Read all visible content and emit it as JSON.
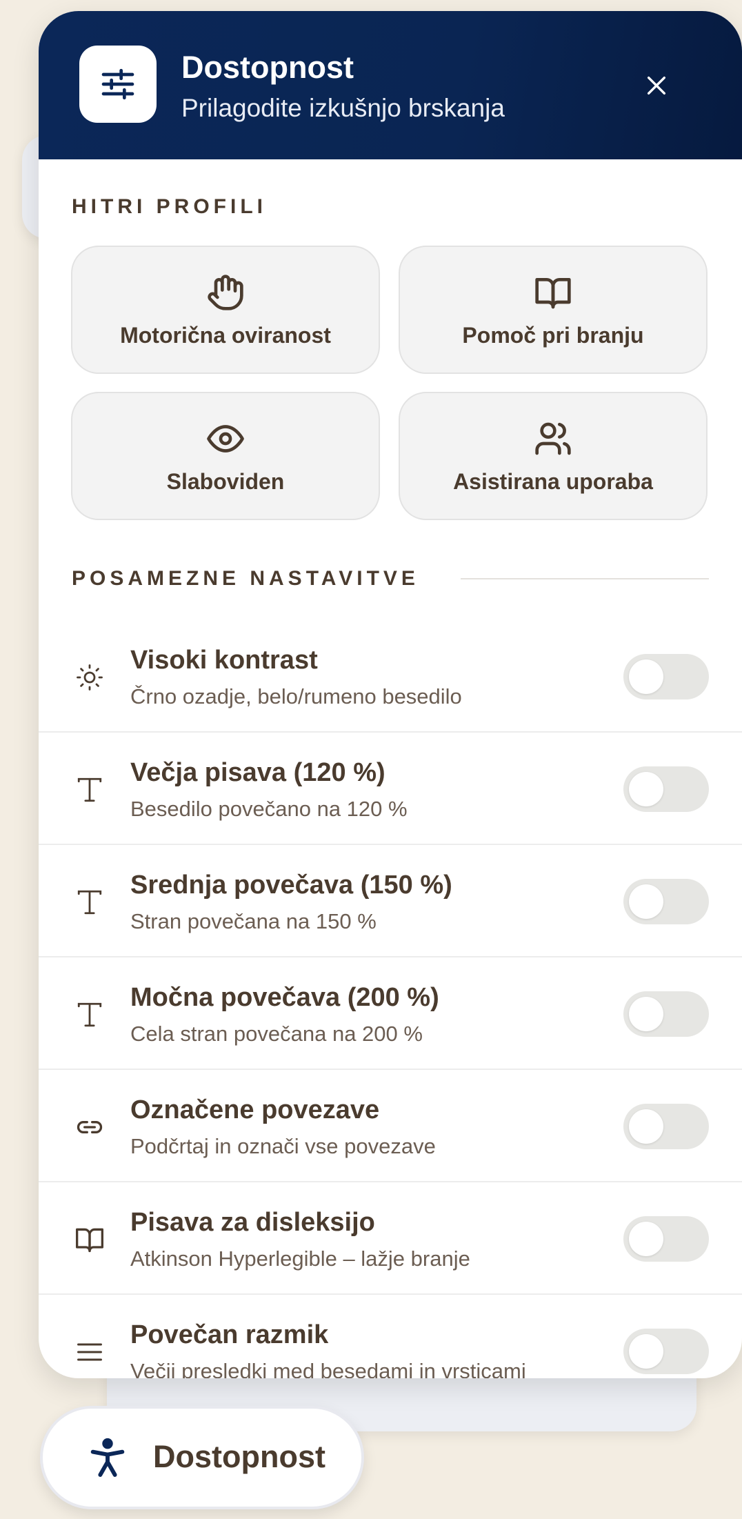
{
  "header": {
    "title": "Dostopnost",
    "subtitle": "Prilagodite izkušnjo brskanja",
    "icon": "sliders-icon",
    "close_icon": "close-icon"
  },
  "quick_profiles": {
    "label": "HITRI PROFILI",
    "items": [
      {
        "label": "Motorična oviranost",
        "icon": "hand-icon"
      },
      {
        "label": "Pomoč pri branju",
        "icon": "book-open-icon"
      },
      {
        "label": "Slaboviden",
        "icon": "eye-icon"
      },
      {
        "label": "Asistirana uporaba",
        "icon": "users-icon"
      }
    ]
  },
  "settings": {
    "label": "POSAMEZNE NASTAVITVE",
    "items": [
      {
        "title": "Visoki kontrast",
        "description": "Črno ozadje, belo/rumeno besedilo",
        "icon": "sun-icon",
        "enabled": false
      },
      {
        "title": "Večja pisava (120 %)",
        "description": "Besedilo povečano na 120 %",
        "icon": "type-icon",
        "enabled": false
      },
      {
        "title": "Srednja povečava (150 %)",
        "description": "Stran povečana na 150 %",
        "icon": "type-icon",
        "enabled": false
      },
      {
        "title": "Močna povečava (200 %)",
        "description": "Cela stran povečana na 200 %",
        "icon": "type-icon",
        "enabled": false
      },
      {
        "title": "Označene povezave",
        "description": "Podčrtaj in označi vse povezave",
        "icon": "link-icon",
        "enabled": false
      },
      {
        "title": "Pisava za disleksijo",
        "description": "Atkinson Hyperlegible – lažje branje",
        "icon": "book-open-icon",
        "enabled": false
      },
      {
        "title": "Povečan razmik",
        "description": "Večji presledki med besedami in vrsticami",
        "icon": "align-justify-icon",
        "enabled": false
      }
    ]
  },
  "fab": {
    "label": "Dostopnost",
    "icon": "accessibility-icon"
  },
  "colors": {
    "header_bg": "#0a2553",
    "text": "#4a3b2e",
    "page_bg": "#f3ede2"
  }
}
